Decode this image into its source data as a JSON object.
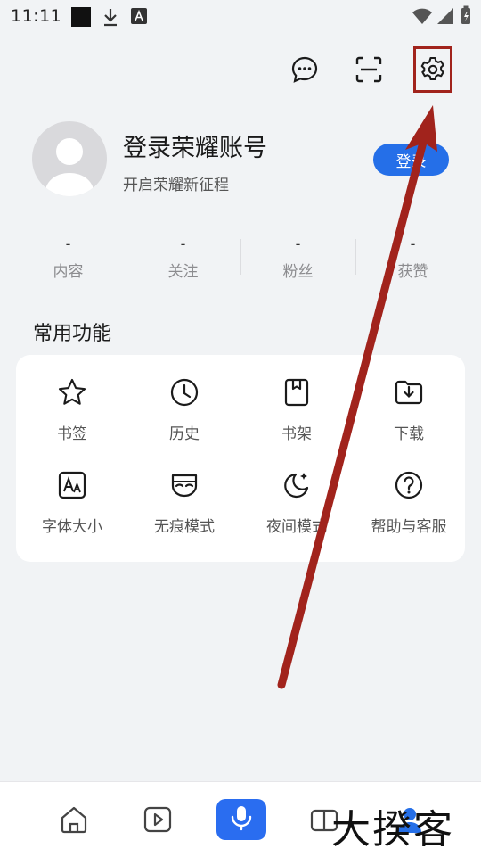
{
  "status_bar": {
    "time": "11:11"
  },
  "top_icons": [
    "message-icon",
    "scan-icon",
    "settings-icon"
  ],
  "profile": {
    "title": "登录荣耀账号",
    "subtitle": "开启荣耀新征程",
    "login_label": "登录"
  },
  "stats": [
    {
      "value": "-",
      "label": "内容"
    },
    {
      "value": "-",
      "label": "关注"
    },
    {
      "value": "-",
      "label": "粉丝"
    },
    {
      "value": "-",
      "label": "获赞"
    }
  ],
  "section_title": "常用功能",
  "features": [
    {
      "label": "书签",
      "icon": "star-icon"
    },
    {
      "label": "历史",
      "icon": "clock-icon"
    },
    {
      "label": "书架",
      "icon": "bookshelf-icon"
    },
    {
      "label": "下载",
      "icon": "download-icon"
    },
    {
      "label": "字体大小",
      "icon": "font-size-icon"
    },
    {
      "label": "无痕模式",
      "icon": "incognito-mask-icon"
    },
    {
      "label": "夜间模式",
      "icon": "night-mode-icon"
    },
    {
      "label": "帮助与客服",
      "icon": "help-icon"
    }
  ],
  "bottom_nav": [
    "home-icon",
    "video-icon",
    "voice-icon",
    "reader-icon",
    "profile-icon"
  ],
  "watermark": "大揆客",
  "colors": {
    "accent": "#256fe8",
    "annotation": "#a1231c",
    "background": "#f1f3f5"
  }
}
